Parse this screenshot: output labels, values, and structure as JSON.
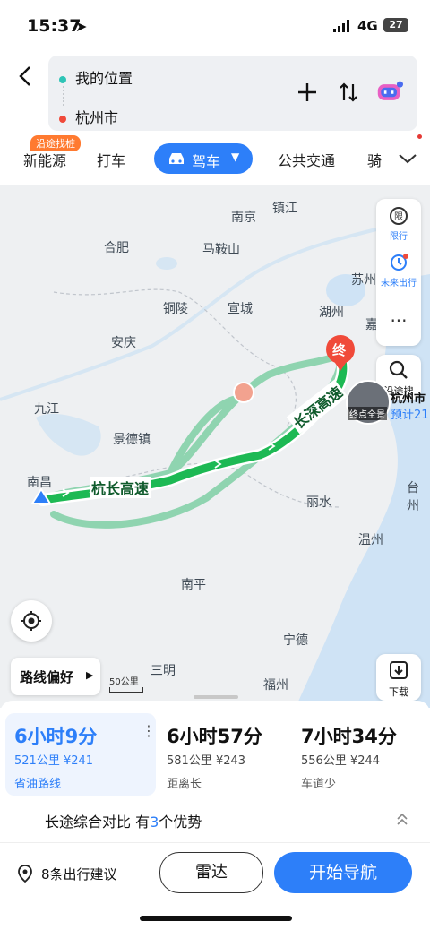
{
  "status_bar": {
    "time": "15:37",
    "network": "4G",
    "battery": "27"
  },
  "route_input": {
    "origin": "我的位置",
    "destination": "杭州市"
  },
  "travel_modes": {
    "promo_tag": "沿途找桩",
    "items": [
      "新能源",
      "打车",
      "驾车",
      "公共交通",
      "骑"
    ],
    "active": "驾车"
  },
  "map": {
    "cities": [
      "南京",
      "镇江",
      "合肥",
      "马鞍山",
      "苏州",
      "铜陵",
      "宣城",
      "湖州",
      "嘉",
      "安庆",
      "九江",
      "景德镇",
      "南昌",
      "丽水",
      "温州",
      "台州",
      "南平",
      "宁德",
      "三明",
      "福州"
    ],
    "road_labels": [
      "杭长高速",
      "长深高速"
    ],
    "end_marker": "终",
    "scale": "50公里",
    "route_pref": "路线偏好",
    "photo_label": "终点全景",
    "dest_name_partial": "杭州市",
    "eta_partial": "预计21"
  },
  "right_panel": {
    "restriction": "限行",
    "future_trip": "未来出行",
    "search_along": "沿途搜",
    "download": "下载"
  },
  "routes": [
    {
      "duration": "6小时9分",
      "distance": "521公里",
      "toll": "¥241",
      "label": "省油路线",
      "selected": true
    },
    {
      "duration": "6小时57分",
      "distance": "581公里",
      "toll": "¥243",
      "label": "距离长",
      "selected": false
    },
    {
      "duration": "7小时34分",
      "distance": "556公里",
      "toll": "¥244",
      "label": "车道少",
      "selected": false
    }
  ],
  "comparison": {
    "prefix": "长途综合对比 有",
    "count": "3",
    "suffix": "个优势"
  },
  "actions": {
    "suggestions": "8条出行建议",
    "radar": "雷达",
    "start": "开始导航"
  },
  "colors": {
    "accent": "#2d7ff9",
    "route_main": "#1db954",
    "route_alt": "#8fd4b0",
    "end_marker": "#f04a3a"
  }
}
